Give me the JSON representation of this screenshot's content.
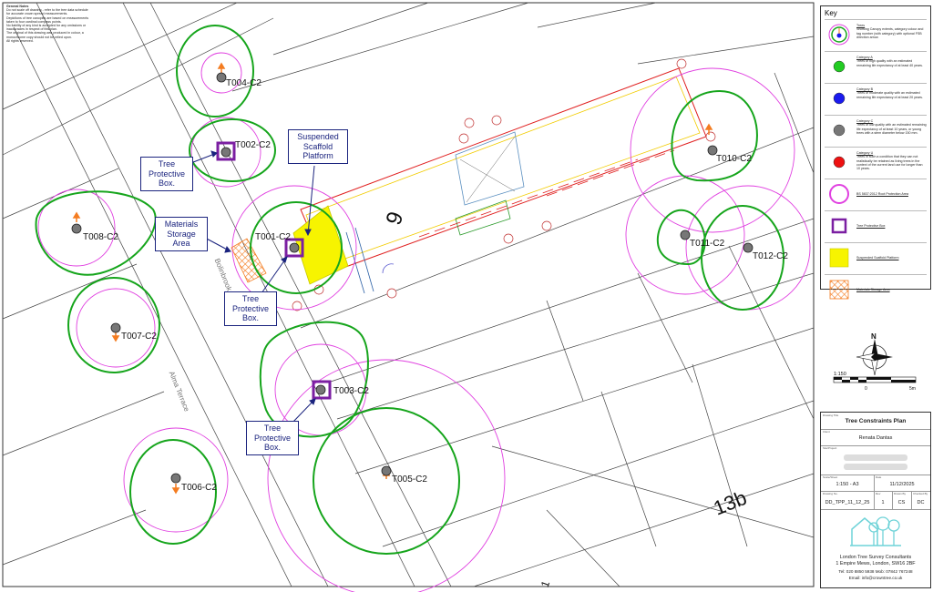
{
  "general_notes": {
    "title": "General Notes",
    "lines": [
      "Do not scale off drawing - refer to the tree data schedule",
      "for accurate crown spread measurements.",
      "Depictions of tree canopies are based on measurements",
      "taken to four cardinal compass points.",
      "No liability of any kind is accepted for any omissions or",
      "inaccuracies in respect of this plan.",
      "The original of this drawing was produced in colour, a",
      "monochrome copy should not be relied upon.",
      "All rights reserved."
    ]
  },
  "trees": [
    {
      "id": "T001-C2",
      "label": "T001-C2"
    },
    {
      "id": "T002-C2",
      "label": "T002-C2"
    },
    {
      "id": "T003-C2",
      "label": "T003-C2"
    },
    {
      "id": "T004-C2",
      "label": "T004-C2"
    },
    {
      "id": "T005-C2",
      "label": "T005-C2"
    },
    {
      "id": "T006-C2",
      "label": "T006-C2"
    },
    {
      "id": "T007-C2",
      "label": "T007-C2"
    },
    {
      "id": "T008-C2",
      "label": "T008-C2"
    },
    {
      "id": "T010-C2",
      "label": "T010-C2"
    },
    {
      "id": "T011-C2",
      "label": "T011-C2"
    },
    {
      "id": "T012-C2",
      "label": "T012-C2"
    }
  ],
  "callouts": {
    "tpb1": "Tree\nProtective\nBox.",
    "scaffold": "Suspended\nScaffold\nPlatform",
    "materials": "Materials\nStorage\nArea",
    "tpb2": "Tree\nProtective\nBox.",
    "tpb3": "Tree\nProtective\nBox."
  },
  "map_text": {
    "house_number": "9",
    "plot_13b": "13b",
    "road_alma": "Alma Terrace",
    "road_other": "Bolinbrook Terrace",
    "corner_mark": "1"
  },
  "key": {
    "title": "Key",
    "items": [
      {
        "heading": "Trees",
        "text": "Showing Canopy extents, category colour and tag number (with category) with optional FSB direction arrow."
      },
      {
        "heading": "Category A",
        "text": "Trees of high quality with an estimated remaining life expectancy of at least 40 years."
      },
      {
        "heading": "Category B",
        "text": "Trees of moderate quality with an estimated remaining life expectancy of at least 20 years."
      },
      {
        "heading": "Category C",
        "text": "Trees of low quality with an estimated remaining life expectancy of at least 10 years, or young trees with a stem diameter below 150 mm."
      },
      {
        "heading": "Category U",
        "text": "Trees in such a condition that they can not realistically be retained as living trees in the context of the current land use for longer than 10 years."
      },
      {
        "heading": "BS 5837:2012 Root Protection Area",
        "text": ""
      },
      {
        "heading": "Tree Protective Box",
        "text": ""
      },
      {
        "heading": "Suspended Scaffold Platform",
        "text": ""
      },
      {
        "heading": "Materials Storage Area",
        "text": ""
      }
    ]
  },
  "scale_bar": {
    "ratio": "1:150",
    "start": "0",
    "end": "5m",
    "north": "N"
  },
  "title_block": {
    "drawing_title_label": "Drawing Title",
    "drawing_title": "Tree Constraints Plan",
    "client_label": "Client",
    "client": "Renata Dantas",
    "site_label": "Site/Project",
    "scale_label": "Scale/Sheet",
    "scale": "1:150 - A3",
    "date_label": "Date",
    "date": "11/12/2025",
    "drawing_no_label": "Drawing No.",
    "drawing_no": "DD_TPP_11_12_25",
    "rev_label": "Rev",
    "rev": "1",
    "drawn_label": "Drawn By",
    "drawn": "CS",
    "checked_label": "Checked By",
    "checked": "DC",
    "company_name": "London Tree Survey Consultants",
    "company_address": "1 Empire Mews, London, SW16 2BF",
    "company_tel": "Tel: 020 8850 5938     Mob: 07842 767248",
    "company_email": "Email: info@crowntree.co.uk"
  },
  "colors": {
    "canopy": "#16a51c",
    "rpa": "#e040e0",
    "tpb": "#7b1fa2",
    "scaffold": "#f7f400",
    "storage": "#f47c20",
    "stem": "#777777",
    "category_a": "#22cc22",
    "category_b": "#1a1aee",
    "category_c": "#777777",
    "category_u": "#ee1111",
    "callout": "#1a237e"
  }
}
